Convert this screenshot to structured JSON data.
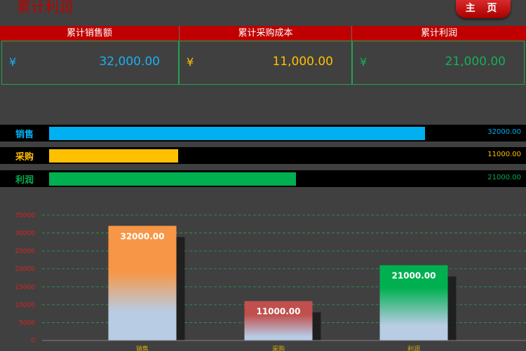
{
  "app": {
    "title": "累计利润",
    "home_label": "主 页"
  },
  "kpis": [
    {
      "header": "累计销售额",
      "currency": "¥",
      "value": "32,000.00",
      "color": "#1ab0f0"
    },
    {
      "header": "累计采购成本",
      "currency": "¥",
      "value": "11,000.00",
      "color": "#ffc000"
    },
    {
      "header": "累计利润",
      "currency": "¥",
      "value": "21,000.00",
      "color": "#12b05a"
    }
  ],
  "progress": {
    "max": 35200,
    "rows": [
      {
        "label": "销售",
        "value": 32000,
        "value_text": "32000.00",
        "color": "#00b0f0"
      },
      {
        "label": "采购",
        "value": 11000,
        "value_text": "11000.00",
        "color": "#ffc000"
      },
      {
        "label": "利润",
        "value": 21000,
        "value_text": "21000.00",
        "color": "#00b050"
      }
    ]
  },
  "chart_data": {
    "type": "bar",
    "categories": [
      "销售",
      "采购",
      "利润"
    ],
    "values": [
      32000,
      11000,
      21000
    ],
    "data_labels": [
      "32000.00",
      "11000.00",
      "21000.00"
    ],
    "ylim": [
      0,
      35000
    ],
    "yticks": [
      0,
      5000,
      10000,
      15000,
      20000,
      25000,
      30000,
      35000
    ],
    "grid": true,
    "colors": [
      "#f79646",
      "#c0504d",
      "#00b050"
    ]
  }
}
